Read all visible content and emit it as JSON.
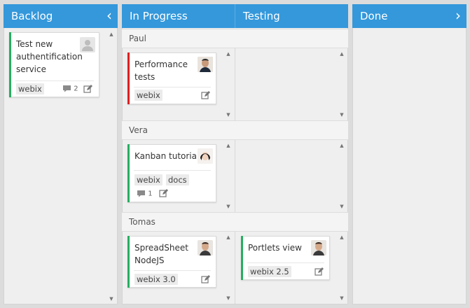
{
  "columns": {
    "backlog": {
      "title": "Backlog",
      "arrow": "‹"
    },
    "inprogress": {
      "title": "In Progress"
    },
    "testing": {
      "title": "Testing"
    },
    "done": {
      "title": "Done",
      "arrow": "›"
    }
  },
  "lanes": [
    {
      "name": "Paul"
    },
    {
      "name": "Vera"
    },
    {
      "name": "Tomas"
    }
  ],
  "cards": {
    "auth": {
      "title": [
        "Test new",
        "authentification",
        "service"
      ],
      "tags": [
        "webix"
      ],
      "comments": "2",
      "status_color": "#27ae60"
    },
    "perf": {
      "title": [
        "Performance",
        "tests"
      ],
      "tags": [
        "webix"
      ],
      "status_color": "#e02020"
    },
    "kanban": {
      "title": [
        "Kanban tutorial"
      ],
      "tags": [
        "webix",
        "docs"
      ],
      "comments": "1",
      "status_color": "#27ae60"
    },
    "spreadsheet": {
      "title": [
        "SpreadSheet",
        "NodeJS"
      ],
      "tags": [
        "webix 3.0"
      ],
      "status_color": "#27ae60"
    },
    "portlets": {
      "title": [
        "Portlets view"
      ],
      "tags": [
        "webix 2.5"
      ],
      "status_color": "#27ae60"
    }
  },
  "colors": {
    "header": "#3498db",
    "panel": "#efefef",
    "background": "#dcdcdc"
  },
  "icons": {
    "edit": "edit-icon",
    "comment": "comment-icon",
    "avatar": "avatar-icon"
  }
}
